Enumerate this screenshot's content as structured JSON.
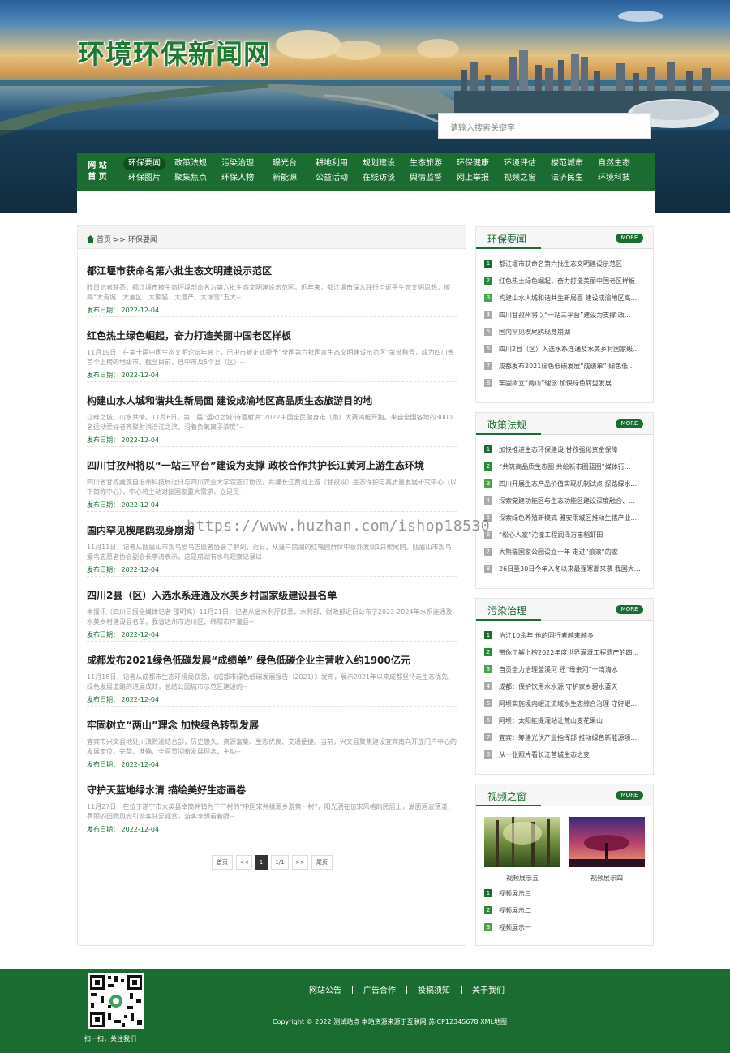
{
  "header": {
    "site_title": "环境环保新闻网",
    "search_placeholder": "请输入搜索关键字"
  },
  "nav": {
    "home_line1": "网 站",
    "home_line2": "首 页",
    "row1": [
      "环保要闻",
      "政策法规",
      "污染治理",
      "曝光台",
      "耕地利用",
      "规划建设",
      "生态旅游",
      "环保健康",
      "环境评估",
      "楼范城市",
      "自然生态"
    ],
    "row2": [
      "环保图片",
      "聚集焦点",
      "环保人物",
      "新能源",
      "公益活动",
      "在线访谈",
      "舆情监督",
      "网上举报",
      "视频之窗",
      "法济民生",
      "环境科技"
    ]
  },
  "breadcrumb": {
    "home": "首页",
    "sep": ">>",
    "current": "环保要闻"
  },
  "articles": [
    {
      "title": "都江堰市获命名第六批生态文明建设示范区",
      "summary": "昨日记者获悉，都江堰市被生态环境部命名为第六批生态文明建设示范区。近年来，都江堰市深入践行习近平生态文明思想，擦亮“大青城、大灌区、大熊猫、大遗产、大冰雪”五大--",
      "date": "发布日期： 2022-12-04"
    },
    {
      "title": "红色热土绿色崛起，奋力打造美丽中国老区样板",
      "summary": "11月19日，在第十届中国生态文明论坛年会上，巴中市被正式授予“全国第六批国家生态文明建设示范区”荣誉称号，成为四川省首个上榜的地级市。截至目前，巴中市及5个县（区）--",
      "date": "发布日期： 2022-12-04"
    },
    {
      "title": "构建山水人城和谐共生新局面 建设成渝地区高品质生态旅游目的地",
      "summary": "江畔之城、山水共情。11月6日，第二届“运动之城·诗酒射洪”2022中国全民健身走（跑）大赛鸣枪开跑。来自全国各地的3000名运动爱好者齐聚射洪涪江之滨，沿着负氧离子浓度“--",
      "date": "发布日期： 2022-12-04"
    },
    {
      "title": "四川甘孜州将以“一站三平台”建设为支撑 政校合作共护长江黄河上游生态环境",
      "summary": "四川省甘孜藏族自治州科技局近日与四川农业大学院签订协议，共建长江黄河上游（甘孜段）生态保护与高质量发展研究中心（以下简称中心），中心将主动对接国家重大需求，立足民--",
      "date": "发布日期： 2022-12-04"
    },
    {
      "title": "国内罕见楔尾鸥现身崩湖",
      "summary": "11月11日，记者从瓯眉山市观鸟爱鸟志愿者协会了解到，近日，从遥户崩湖的红嘴鸥群体中意外发现1只楔尾鸥。瓯眉山市观鸟爱鸟志愿者协会副会长李涛表示，这是崩湖有水鸟观察记录以--",
      "date": "发布日期： 2022-12-04"
    },
    {
      "title": "四川2县（区）入选水系连通及水美乡村国家级建设县名单",
      "summary": "本报讯（四川日报全媒体记者 邵明亮）11月21日，记者从省水利厅获悉，水利部、财政部近日公布了2023-2024年水系连通及水美乡村建设县名单，我省达州市达川区、绵阳市梓潼县--",
      "date": "发布日期： 2022-12-04"
    },
    {
      "title": "成都发布2021绿色低碳发展“成绩单” 绿色低碳企业主营收入约1900亿元",
      "summary": "11月18日，记者从成都市生态环境局获悉，《成都市绿色低碳发展报告（2021）》发布，展示2021年以来成都坚持走生态优先、绿色发展道路的进展成效，总结公园城市示范区建设的--",
      "date": "发布日期： 2022-12-04"
    },
    {
      "title": "牢固树立“两山”理念 加快绿色转型发展",
      "summary": "宜宾市兴文县地处川滇黔渝结合部，历史悠久、资源富集、生态优良、交通便捷。当前，兴文县聚焦建设宜宾南向开放门户中心的发展定位，完整、准确、全面贯彻新发展理念，主动--",
      "date": "发布日期： 2022-12-04"
    },
    {
      "title": "守护天蓝地绿水清 描绘美好生态画卷",
      "summary": "11月27日，在位于遂宁市大英县卓筒井镇为干厂村的“中国宋井桃源乡游第一村”，阳光洒在仿宋风格的民居上，湖面碧波荡漾，秀丽的田园风光引游客驻足观赏。游客李想看着眼--",
      "date": "发布日期： 2022-12-04"
    }
  ],
  "pager": {
    "first": "首页",
    "prev": "<<",
    "current": "1",
    "total": "1/1",
    "next": ">>",
    "last": "尾页"
  },
  "sidebar": {
    "more": "MORE",
    "sections": [
      {
        "name": "环保要闻",
        "items": [
          "都江堰市获命名第六批生态文明建设示范区",
          "红色热土绿色崛起，奋力打造美丽中国老区样板",
          "构建山水人城和谐共生新局面 建设成渝地区高...",
          "四川甘孜州将以“一站三平台”建设为支撑 政...",
          "国内罕见楔尾鸥现身崩湖",
          "四川2县（区）入选水系连通及水美乡村国家级...",
          "成都发布2021绿色低碳发展“成绩单” 绿色低...",
          "牢固树立“两山”理念 加快绿色转型发展"
        ]
      },
      {
        "name": "政策法规",
        "items": [
          "加快推进生态环保建设 甘孜强化资金保障",
          "“共筑高品质生态圈 共绘新市圈蓝图”媒体行...",
          "四川开展生态产品价值实现机制试点 探路绿水...",
          "探索党建功能区与生态功能区建设深度融合、...",
          "探索绿色养殖新模式 雅安雨城区推动生猪产业...",
          "“松心人家”沱潼工程润泽万亩稻虾田",
          "大熊猫国家公园设立一年 走进“滚滚”的家",
          "26日至30日今年入冬以来最强寒潮来袭 我国大..."
        ]
      },
      {
        "name": "污染治理",
        "items": [
          "治江10余年 他的同行者越来越多",
          "带你了解上榜2022年度世界灌溉工程遗产的四...",
          "自贡全力治理釜溪河 还“母亲河”一湾清水",
          "成都：保护饮用水水源 守护家乡碧水蓝天",
          "阿坝实施境内岷江流域水生态综合治理 守好岷...",
          "阿坝：太阳能提灌站让荒山变花果山",
          "宜宾：筹建光伏产业指挥部 推动绿色新能源项...",
          "从一张照片看长江首城生态之变"
        ]
      },
      {
        "name": "视频之窗",
        "videos": [
          "视频展示五",
          "视频展示四"
        ],
        "items": [
          "视频展示三",
          "视频展示二",
          "视频展示一"
        ]
      }
    ]
  },
  "footer": {
    "links": [
      "网站公告",
      "广告合作",
      "投稿须知",
      "关于我们"
    ],
    "copyright": "Copyright © 2022 测试站点 本站资源来源于互联网 苏ICP12345678 XML地图",
    "qr_caption": "扫一扫，关注我们"
  },
  "watermark": "https://www.huzhan.com/ishop18530"
}
